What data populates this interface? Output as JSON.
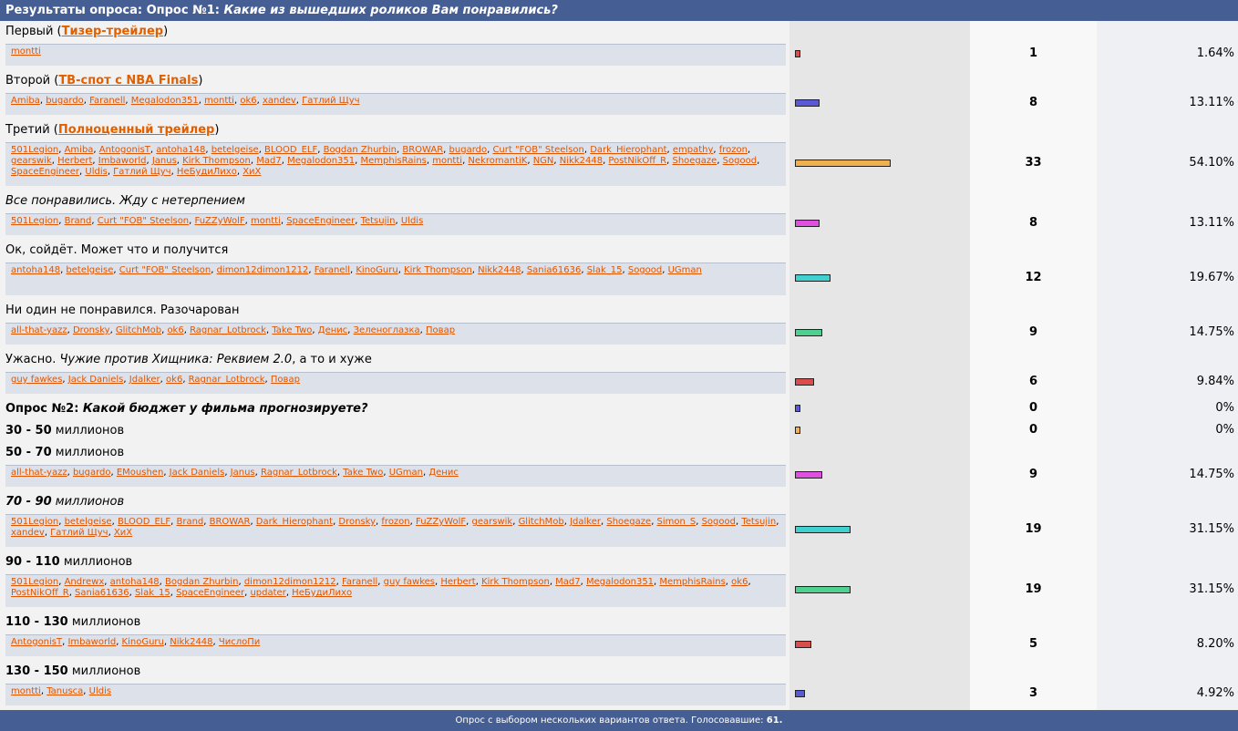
{
  "header": {
    "prefix": "Результаты опроса: Опрос №1:",
    "question": "Какие из вышедших роликов Вам понравились?"
  },
  "footer": {
    "text": "Опрос с выбором нескольких вариантов ответа. Голосовавшие:",
    "total": "61."
  },
  "colors": {
    "red": "#d94d4d",
    "blue": "#5a5ad9",
    "orange": "#f0b050",
    "magenta": "#e050e0",
    "cyan": "#40d0d0",
    "green": "#50d090",
    "link": "#e05500"
  },
  "rows": [
    {
      "label": "Первый (",
      "link": "Тизер-трейлер",
      "suffix": ")",
      "voters": [
        "montti"
      ],
      "count": "1",
      "pct": "1.64%",
      "fraction": 0.0164,
      "color": "red"
    },
    {
      "label": "Второй (",
      "link": "ТВ-спот с NBA Finals",
      "suffix": ")",
      "voters": [
        "Amiba",
        "bugardo",
        "Faranell",
        "Megalodon351",
        "montti",
        "ok6",
        "xandev",
        "Гатлий Щуч"
      ],
      "count": "8",
      "pct": "13.11%",
      "fraction": 0.1311,
      "color": "blue"
    },
    {
      "label": "Третий (",
      "link": "Полноценный трейлер",
      "suffix": ")",
      "voters": [
        "501Legion",
        "Amiba",
        "AntogonisT",
        "antoha148",
        "betelgeise",
        "BLOOD_ELF",
        "Bogdan Zhurbin",
        "BROWAR",
        "bugardo",
        "Curt \"FOB\" Steelson",
        "Dark_Hierophant",
        "empathy",
        "frozon",
        "gearswik",
        "Herbert",
        "Imbaworld",
        "Janus",
        "Kirk Thompson",
        "Mad7",
        "Megalodon351",
        "MemphisRains",
        "montti",
        "NekromantiK",
        "NGN",
        "Nikk2448",
        "PostNikOff_R",
        "Shoegaze",
        "Sogood",
        "SpaceEngineer",
        "Uldis",
        "Гатлий Щуч",
        "НеБудиЛихо",
        "ХиХ"
      ],
      "count": "33",
      "pct": "54.10%",
      "fraction": 0.541,
      "color": "orange"
    },
    {
      "italic": "Все понравились. Жду с нетерпением",
      "voters": [
        "501Legion",
        "Brand",
        "Curt \"FOB\" Steelson",
        "FuZZyWolF",
        "montti",
        "SpaceEngineer",
        "Tetsujin",
        "Uldis"
      ],
      "count": "8",
      "pct": "13.11%",
      "fraction": 0.1311,
      "color": "magenta"
    },
    {
      "label": "Ок, сойдёт. Может что и получится",
      "voters": [
        "antoha148",
        "betelgeise",
        "Curt \"FOB\" Steelson",
        "dimon12dimon1212",
        "Faranell",
        "KinoGuru",
        "Kirk Thompson",
        "Nikk2448",
        "Sania61636",
        "Slak_15",
        "Sogood",
        "UGman"
      ],
      "count": "12",
      "pct": "19.67%",
      "fraction": 0.1967,
      "color": "cyan"
    },
    {
      "label": "Ни один не понравился. Разочарован",
      "voters": [
        "all-that-yazz",
        "Dronsky",
        "GlitchMob",
        "ok6",
        "Ragnar_Lotbrock",
        "Take Two",
        "Денис",
        "Зеленоглазка",
        "Повар"
      ],
      "count": "9",
      "pct": "14.75%",
      "fraction": 0.1475,
      "color": "green"
    },
    {
      "label": "Ужасно. ",
      "italic": "Чужие против Хищника: Реквием 2.0",
      "suffix": ", а то и хуже",
      "voters": [
        "guy fawkes",
        "Jack Daniels",
        "Jdalker",
        "ok6",
        "Ragnar_Lotbrock",
        "Повар"
      ],
      "count": "6",
      "pct": "9.84%",
      "fraction": 0.0984,
      "color": "red"
    },
    {
      "bold": "Опрос №2: ",
      "boldItalic": "Какой бюджет у фильма прогнозируете?",
      "voters": [],
      "count": "0",
      "pct": "0%",
      "fraction": 0,
      "color": "blue"
    },
    {
      "bold": "30 - 50",
      "suffix": " миллионов",
      "voters": [],
      "count": "0",
      "pct": "0%",
      "fraction": 0,
      "color": "orange"
    },
    {
      "bold": "50 - 70",
      "suffix": " миллионов",
      "voters": [
        "all-that-yazz",
        "bugardo",
        "EMoushen",
        "Jack Daniels",
        "Janus",
        "Ragnar_Lotbrock",
        "Take Two",
        "UGman",
        "Денис"
      ],
      "count": "9",
      "pct": "14.75%",
      "fraction": 0.1475,
      "color": "magenta"
    },
    {
      "boldItalic": "70 - 90",
      "italic": " миллионов",
      "voters": [
        "501Legion",
        "betelgeise",
        "BLOOD_ELF",
        "Brand",
        "BROWAR",
        "Dark_Hierophant",
        "Dronsky",
        "frozon",
        "FuZZyWolF",
        "gearswik",
        "GlitchMob",
        "Jdalker",
        "Shoegaze",
        "Simon_S",
        "Sogood",
        "Tetsujin",
        "xandev",
        "Гатлий Щуч",
        "ХиХ"
      ],
      "count": "19",
      "pct": "31.15%",
      "fraction": 0.3115,
      "color": "cyan"
    },
    {
      "bold": "90 - 110",
      "suffix": " миллионов",
      "voters": [
        "501Legion",
        "Andrewx",
        "antoha148",
        "Bogdan Zhurbin",
        "dimon12dimon1212",
        "Faranell",
        "guy fawkes",
        "Herbert",
        "Kirk Thompson",
        "Mad7",
        "Megalodon351",
        "MemphisRains",
        "ok6",
        "PostNikOff_R",
        "Sania61636",
        "Slak_15",
        "SpaceEngineer",
        "updater",
        "НеБудиЛихо"
      ],
      "count": "19",
      "pct": "31.15%",
      "fraction": 0.3115,
      "color": "green"
    },
    {
      "bold": "110 - 130",
      "suffix": " миллионов",
      "voters": [
        "AntogonisT",
        "Imbaworld",
        "KinoGuru",
        "Nikk2448",
        "ЧислоПи"
      ],
      "count": "5",
      "pct": "8.20%",
      "fraction": 0.082,
      "color": "red"
    },
    {
      "bold": "130 - 150",
      "suffix": " миллионов",
      "voters": [
        "montti",
        "Tanusca",
        "Uldis"
      ],
      "count": "3",
      "pct": "4.92%",
      "fraction": 0.0492,
      "color": "blue"
    }
  ]
}
